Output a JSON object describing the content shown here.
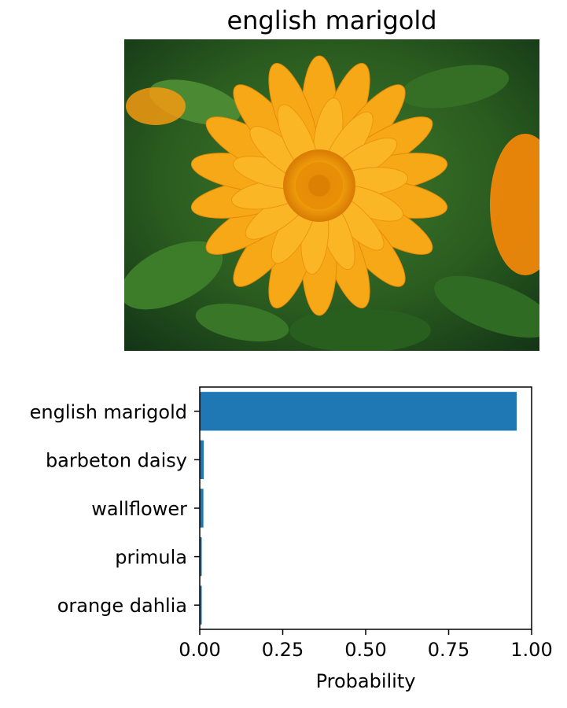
{
  "figure": {
    "image_title": "english marigold",
    "photo_subject": "orange marigold flower"
  },
  "chart_data": {
    "type": "bar",
    "orientation": "horizontal",
    "categories": [
      "english marigold",
      "barbeton daisy",
      "wallflower",
      "primula",
      "orange dahlia"
    ],
    "values": [
      0.955,
      0.012,
      0.011,
      0.006,
      0.006
    ],
    "xlabel": "Probability",
    "ylabel": "",
    "xlim": [
      0,
      1.0
    ],
    "xticks": [
      "0.00",
      "0.25",
      "0.50",
      "0.75",
      "1.00"
    ],
    "bar_color": "#1f77b4",
    "grid": false
  }
}
